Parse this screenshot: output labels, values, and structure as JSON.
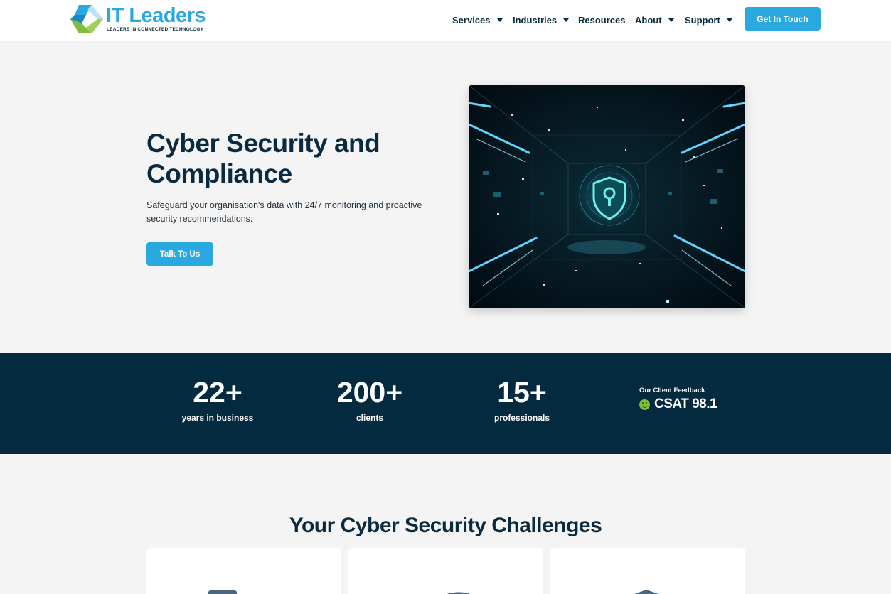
{
  "header": {
    "logo": {
      "word_it": "IT",
      "word_leaders": "Leaders",
      "tagline": "LEADERS IN CONNECTED TECHNOLOGY"
    },
    "nav": [
      {
        "label": "Services",
        "has_dropdown": true
      },
      {
        "label": "Industries",
        "has_dropdown": true
      },
      {
        "label": "Resources",
        "has_dropdown": false
      },
      {
        "label": "About",
        "has_dropdown": true
      },
      {
        "label": "Support",
        "has_dropdown": true
      }
    ],
    "cta_label": "Get In Touch"
  },
  "hero": {
    "title": "Cyber Security and Compliance",
    "subtitle": "Safeguard your organisation's data with 24/7 monitoring and proactive security recommendations.",
    "cta_label": "Talk To Us",
    "image_icon": "shield-keyhole-icon"
  },
  "stats": [
    {
      "value": "22+",
      "label": "years in business"
    },
    {
      "value": "200+",
      "label": "clients"
    },
    {
      "value": "15+",
      "label": "professionals"
    }
  ],
  "feedback": {
    "label": "Our Client Feedback",
    "csat": "CSAT 98.1"
  },
  "challenges": {
    "title": "Your Cyber Security Challenges"
  },
  "colors": {
    "accent": "#2aa8e0",
    "navy": "#042a40",
    "logo_green": "#7dbf3a",
    "background": "#f4f4f4"
  }
}
